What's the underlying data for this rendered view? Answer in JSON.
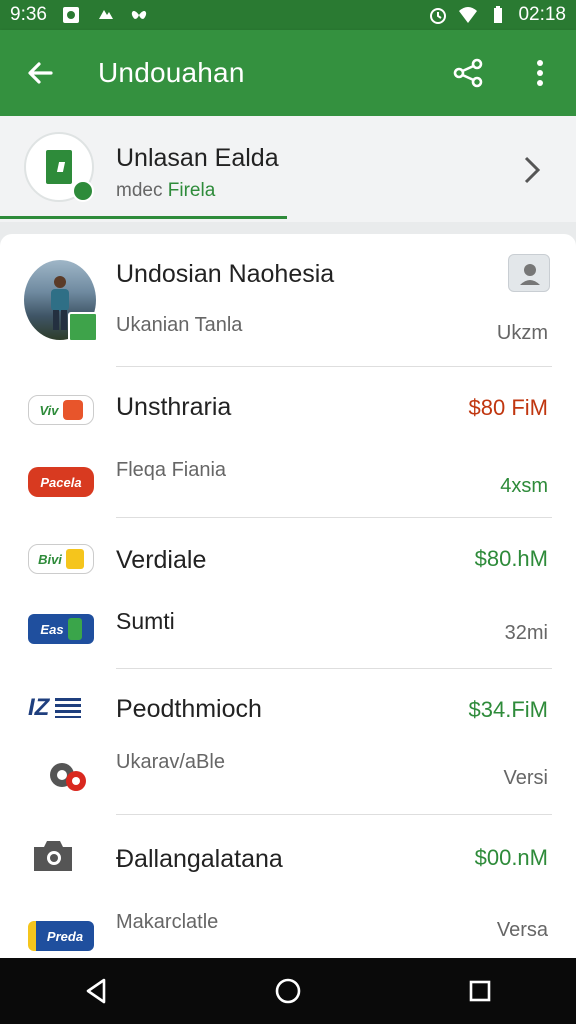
{
  "status_bar": {
    "time_left": "9:36",
    "time_right": "02:18",
    "icons": [
      "photo-icon",
      "cloud-icon",
      "butterfly-icon",
      "alarm-icon",
      "wifi-icon",
      "battery-icon"
    ]
  },
  "app_bar": {
    "title": "Undouahan",
    "icons": [
      "back-arrow-icon",
      "share-icon",
      "more-vert-icon"
    ]
  },
  "account": {
    "title": "Unlasan Ealda",
    "sub_prefix": "mdec",
    "sub_accent": "Firela"
  },
  "list": [
    {
      "primary_title": "Undosian Naohesia",
      "primary_right": "",
      "secondary_title": "Ukanian Tanla",
      "secondary_right": "Ukzm",
      "right_color": "#222222"
    },
    {
      "logo_top": "Viv",
      "logo_bottom": "Pacela",
      "primary_title": "Unsthraria",
      "primary_right": "$80 FiM",
      "secondary_title": "Fleqa Fiania",
      "secondary_right": "4xsm",
      "right_color": "#c0360f",
      "secondary_right_color": "#2e8b3a"
    },
    {
      "logo_top": "Bivi",
      "logo_bottom": "Eas",
      "primary_title": "Verdiale",
      "primary_right": "$80.hM",
      "secondary_title": "Sumti",
      "secondary_right": "32mi",
      "right_color": "#2e8b3a"
    },
    {
      "logo_top": "IZ",
      "logo_bottom": "",
      "primary_title": "Peodthmioch",
      "primary_right": "$34.FiM",
      "secondary_title": "Ukarav/aBle",
      "secondary_right": "Versi",
      "right_color": "#2e8b3a"
    },
    {
      "logo_top": "",
      "logo_bottom": "Preda",
      "primary_title": "Ðallangalatana",
      "primary_right": "$00.nM",
      "secondary_title": "Makarclatle",
      "secondary_right": "Versa",
      "right_color": "#2e8b3a"
    }
  ],
  "colors": {
    "app_bar": "#34913f",
    "status_bar": "#2a7a32",
    "accent_green": "#2e8b3a",
    "accent_orange": "#c0360f"
  },
  "nav_bar": {
    "icons": [
      "back-triangle-icon",
      "home-circle-icon",
      "recents-square-icon"
    ]
  }
}
